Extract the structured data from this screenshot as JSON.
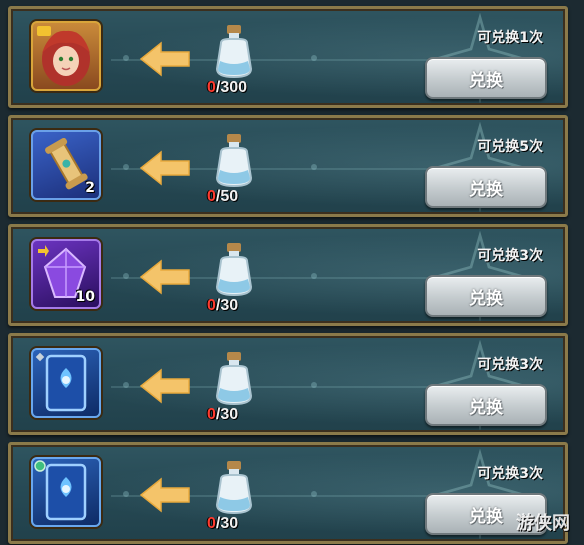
{
  "exchange_list": {
    "items": [
      {
        "reward_icon": "hero-portrait-icon",
        "reward_qty": "",
        "cost_icon": "potion-bottle-icon",
        "have": "0",
        "need": "/300",
        "limit": "可兑换1次",
        "button": "兑换"
      },
      {
        "reward_icon": "scroll-icon",
        "reward_qty": "2",
        "cost_icon": "potion-bottle-icon",
        "have": "0",
        "need": "/50",
        "limit": "可兑换5次",
        "button": "兑换"
      },
      {
        "reward_icon": "purple-crystal-icon",
        "reward_qty": "10",
        "cost_icon": "potion-bottle-icon",
        "have": "0",
        "need": "/30",
        "limit": "可兑换3次",
        "button": "兑换"
      },
      {
        "reward_icon": "blue-card-icon",
        "reward_qty": "",
        "cost_icon": "potion-bottle-icon",
        "have": "0",
        "need": "/30",
        "limit": "可兑换3次",
        "button": "兑换"
      },
      {
        "reward_icon": "blue-card-icon",
        "reward_qty": "",
        "cost_icon": "potion-bottle-icon",
        "have": "0",
        "need": "/30",
        "limit": "可兑换3次",
        "button": "兑换"
      }
    ]
  },
  "colors": {
    "insufficient": "#ff3b2f",
    "frame": "#8b7a4a",
    "panel": "#274a55"
  },
  "watermark": "游侠网"
}
